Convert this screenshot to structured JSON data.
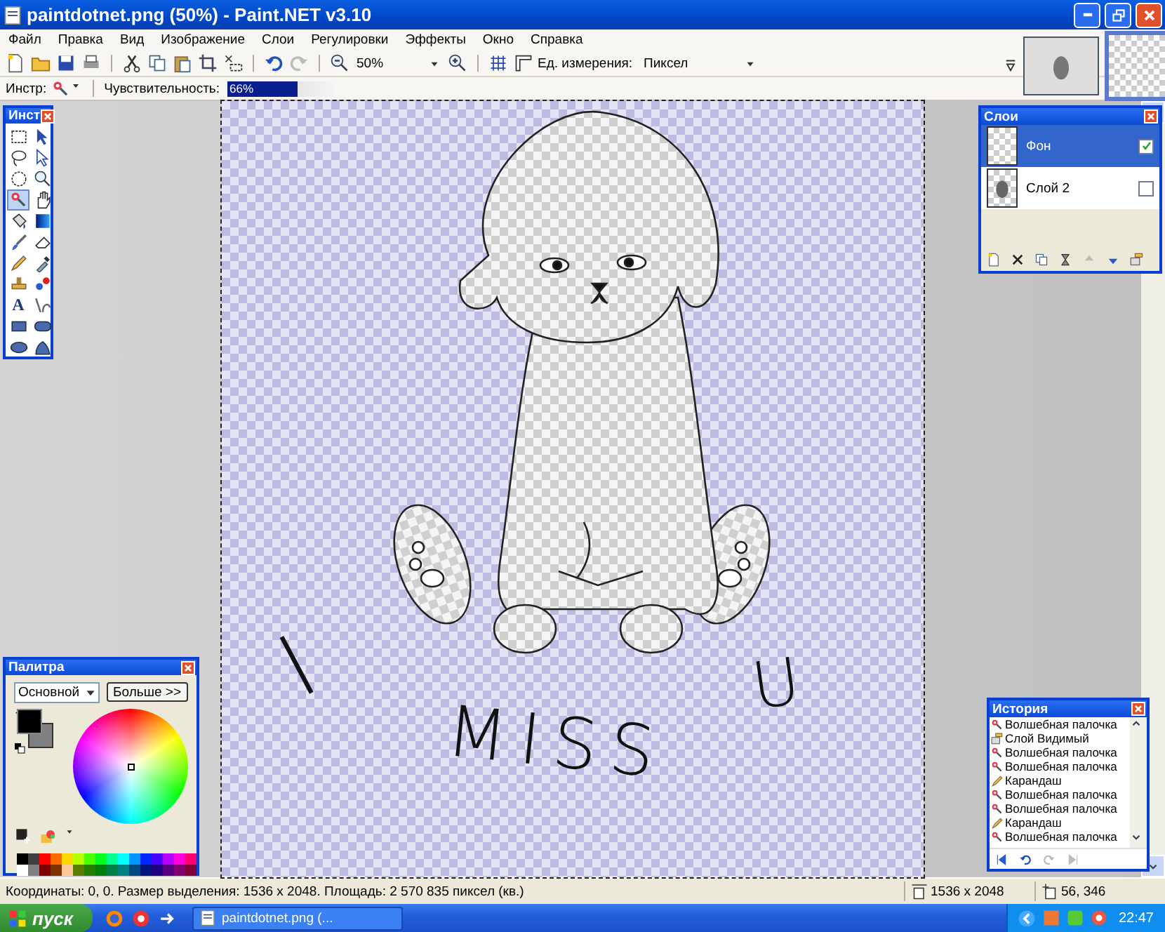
{
  "window": {
    "title": "paintdotnet.png (50%) - Paint.NET v3.10"
  },
  "menu": [
    "Файл",
    "Правка",
    "Вид",
    "Изображение",
    "Слои",
    "Регулировки",
    "Эффекты",
    "Окно",
    "Справка"
  ],
  "toolbar": {
    "zoom": "50%",
    "units_label": "Ед. измерения:",
    "units": "Пиксел"
  },
  "tool_options": {
    "tool_label": "Инстр:",
    "sensitivity_label": "Чувствительность:",
    "sensitivity": "66%",
    "level": 0.66
  },
  "tools_window": {
    "title": "Инст",
    "tools": [
      {
        "kind": "rect-select",
        "selected": false
      },
      {
        "kind": "move-selection",
        "selected": false
      },
      {
        "kind": "lasso",
        "selected": false
      },
      {
        "kind": "move-selected",
        "selected": false
      },
      {
        "kind": "ellipse-select",
        "selected": false
      },
      {
        "kind": "zoom",
        "selected": false
      },
      {
        "kind": "magic-wand",
        "selected": true
      },
      {
        "kind": "pan",
        "selected": false
      },
      {
        "kind": "bucket",
        "selected": false
      },
      {
        "kind": "gradient",
        "selected": false
      },
      {
        "kind": "brush",
        "selected": false
      },
      {
        "kind": "eraser",
        "selected": false
      },
      {
        "kind": "pencil",
        "selected": false
      },
      {
        "kind": "picker",
        "selected": false
      },
      {
        "kind": "stamp",
        "selected": false
      },
      {
        "kind": "recolor",
        "selected": false
      },
      {
        "kind": "text",
        "glyph": "A",
        "selected": false
      },
      {
        "kind": "line",
        "selected": false
      },
      {
        "kind": "rectangle",
        "selected": false
      },
      {
        "kind": "rounded",
        "selected": false
      },
      {
        "kind": "ellipse",
        "selected": false
      },
      {
        "kind": "freeform",
        "selected": false
      }
    ]
  },
  "canvas": {
    "texts": [
      "I",
      "MISS",
      "U"
    ]
  },
  "layers": {
    "title": "Слои",
    "items": [
      {
        "name": "Фон",
        "visible": true,
        "selected": true
      },
      {
        "name": "Слой 2",
        "visible": false,
        "selected": false
      }
    ]
  },
  "palette": {
    "title": "Палитра",
    "preset": "Основной",
    "more_button": "Больше >>",
    "swatches": [
      {
        "color": "#000000"
      },
      {
        "color": "#404040"
      },
      {
        "color": "#ff0000"
      },
      {
        "color": "#ff6a00"
      },
      {
        "color": "#ffd800"
      },
      {
        "color": "#b6ff00"
      },
      {
        "color": "#4cff00"
      },
      {
        "color": "#00ff21"
      },
      {
        "color": "#00ff90"
      },
      {
        "color": "#00ffff"
      },
      {
        "color": "#0094ff"
      },
      {
        "color": "#0026ff"
      },
      {
        "color": "#4800ff"
      },
      {
        "color": "#b200ff"
      },
      {
        "color": "#ff00dc"
      },
      {
        "color": "#ff006e"
      },
      {
        "color": "#ffffff"
      },
      {
        "color": "#808080"
      },
      {
        "color": "#7f0000"
      },
      {
        "color": "#7f3300"
      },
      {
        "color": "#ffc896"
      },
      {
        "color": "#5b7f00"
      },
      {
        "color": "#267f00"
      },
      {
        "color": "#007f0e"
      },
      {
        "color": "#007f46"
      },
      {
        "color": "#007f7f"
      },
      {
        "color": "#004a7f"
      },
      {
        "color": "#00137f"
      },
      {
        "color": "#21007f"
      },
      {
        "color": "#57007f"
      },
      {
        "color": "#7f006e"
      },
      {
        "color": "#7f0037"
      }
    ]
  },
  "history": {
    "title": "История",
    "items": [
      {
        "kind": "wand",
        "label": "Волшебная палочка"
      },
      {
        "kind": "layer",
        "label": "Слой Видимый"
      },
      {
        "kind": "wand",
        "label": "Волшебная палочка"
      },
      {
        "kind": "wand",
        "label": "Волшебная палочка"
      },
      {
        "kind": "pencil",
        "label": "Карандаш"
      },
      {
        "kind": "wand",
        "label": "Волшебная палочка"
      },
      {
        "kind": "wand",
        "label": "Волшебная палочка"
      },
      {
        "kind": "pencil",
        "label": "Карандаш"
      },
      {
        "kind": "wand",
        "label": "Волшебная палочка"
      }
    ]
  },
  "status_bar": {
    "info": "Координаты: 0, 0. Размер выделения: 1536 x 2048. Площадь: 2 570 835 пиксел (кв.)",
    "size": "1536 x 2048",
    "cursor": "56, 346"
  },
  "taskbar": {
    "start": "пуск",
    "tasks": [
      {
        "label": "paintdotnet.png (...",
        "selected": false
      }
    ],
    "clock": "22:47"
  }
}
